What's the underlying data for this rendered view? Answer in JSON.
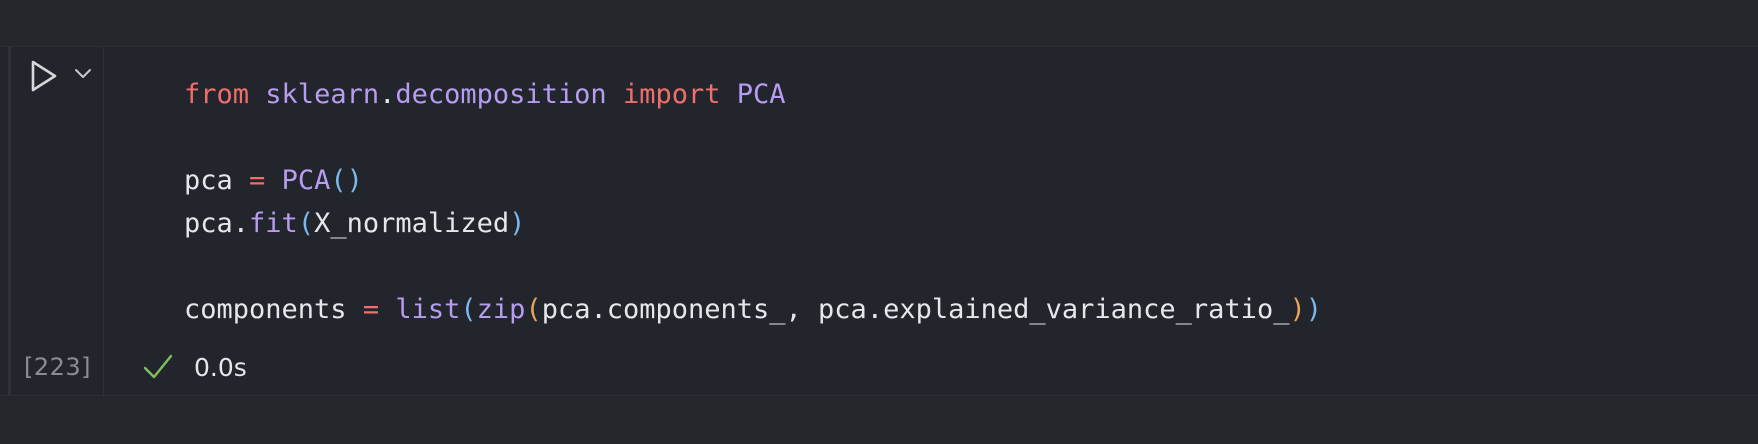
{
  "cell": {
    "execution_count": "[223]",
    "status": {
      "icon": "check-icon",
      "duration": "0.0s",
      "color": "#7fbf5f"
    },
    "run_button_icon": "play-icon",
    "run_menu_icon": "chevron-down-icon",
    "code_lines": [
      [
        {
          "t": "from",
          "c": "kw"
        },
        {
          "t": " ",
          "c": "txt"
        },
        {
          "t": "sklearn",
          "c": "mod"
        },
        {
          "t": ".",
          "c": "txt"
        },
        {
          "t": "decomposition",
          "c": "mod"
        },
        {
          "t": " ",
          "c": "txt"
        },
        {
          "t": "import",
          "c": "kw"
        },
        {
          "t": " ",
          "c": "txt"
        },
        {
          "t": "PCA",
          "c": "mod"
        }
      ],
      [],
      [
        {
          "t": "pca",
          "c": "txt"
        },
        {
          "t": " ",
          "c": "txt"
        },
        {
          "t": "=",
          "c": "op"
        },
        {
          "t": " ",
          "c": "txt"
        },
        {
          "t": "PCA",
          "c": "fn"
        },
        {
          "t": "()",
          "c": "p1"
        }
      ],
      [
        {
          "t": "pca.",
          "c": "txt"
        },
        {
          "t": "fit",
          "c": "fn"
        },
        {
          "t": "(",
          "c": "p1"
        },
        {
          "t": "X_normalized",
          "c": "txt"
        },
        {
          "t": ")",
          "c": "p1"
        }
      ],
      [],
      [
        {
          "t": "components",
          "c": "txt"
        },
        {
          "t": " ",
          "c": "txt"
        },
        {
          "t": "=",
          "c": "op"
        },
        {
          "t": " ",
          "c": "txt"
        },
        {
          "t": "list",
          "c": "fn"
        },
        {
          "t": "(",
          "c": "p1"
        },
        {
          "t": "zip",
          "c": "fn"
        },
        {
          "t": "(",
          "c": "p2"
        },
        {
          "t": "pca.components_, pca.explained_variance_ratio_",
          "c": "txt"
        },
        {
          "t": ")",
          "c": "p2"
        },
        {
          "t": ")",
          "c": "p1"
        }
      ]
    ]
  }
}
